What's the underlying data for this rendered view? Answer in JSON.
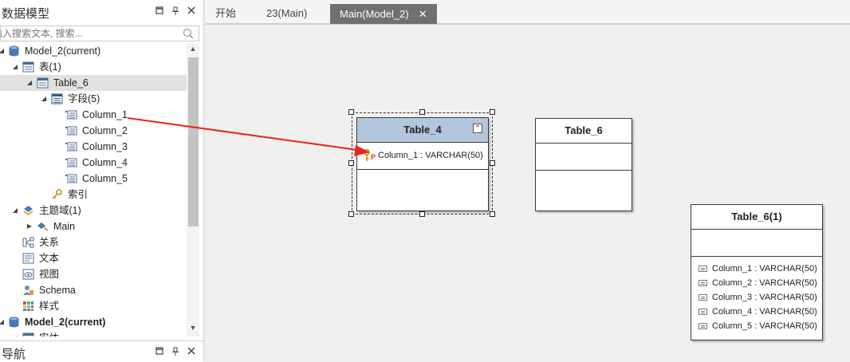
{
  "left_panel": {
    "title": "数据模型",
    "search_placeholder": "输入搜索文本, 搜索...",
    "tree": [
      {
        "label": "Model_2(current)",
        "bold": false
      },
      {
        "label": "表(1)"
      },
      {
        "label": "Table_6"
      },
      {
        "label": "字段(5)"
      },
      {
        "label": "Column_1"
      },
      {
        "label": "Column_2"
      },
      {
        "label": "Column_3"
      },
      {
        "label": "Column_4"
      },
      {
        "label": "Column_5"
      },
      {
        "label": "索引"
      },
      {
        "label": "主题域(1)"
      },
      {
        "label": "Main"
      },
      {
        "label": "关系"
      },
      {
        "label": "文本"
      },
      {
        "label": "视图"
      },
      {
        "label": "Schema"
      },
      {
        "label": "样式"
      },
      {
        "label": "Model_2(current)",
        "bold": true
      },
      {
        "label": "实体"
      }
    ]
  },
  "nav_panel": {
    "title": "导航"
  },
  "tabs": [
    {
      "label": "开始"
    },
    {
      "label": "23(Main)"
    },
    {
      "label": "Main(Model_2)",
      "active": true
    }
  ],
  "diagram": {
    "table4": {
      "title": "Table_4",
      "pk_field": "Column_1 : VARCHAR(50)",
      "pk_marker": "P"
    },
    "table6": {
      "title": "Table_6"
    },
    "table6_1": {
      "title": "Table_6(1)",
      "fields": [
        "Column_1 : VARCHAR(50)",
        "Column_2 : VARCHAR(50)",
        "Column_3 : VARCHAR(50)",
        "Column_4 : VARCHAR(50)",
        "Column_5 : VARCHAR(50)"
      ]
    }
  },
  "colors": {
    "selected_header": "#b4c6dd",
    "arrow": "#e8261c",
    "active_tab": "#707070"
  }
}
